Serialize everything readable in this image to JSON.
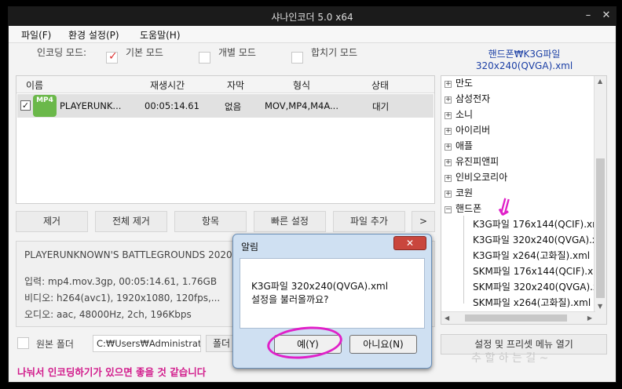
{
  "window": {
    "title": "샤나인코더  5.0  x64",
    "minimize": "–",
    "close": "✕"
  },
  "menu": {
    "file": "파일(F)",
    "settings": "환경 설정(P)",
    "help": "도움말(H)"
  },
  "modes": {
    "label": "인코딩 모드:",
    "basic": "기본 모드",
    "individual": "개별 모드",
    "merge": "합치기 모드"
  },
  "preset": {
    "path_line1": "핸드폰₩K3G파일",
    "path_line2": "320x240(QVGA).xml"
  },
  "list": {
    "headers": {
      "name": "이름",
      "duration": "재생시간",
      "subtitle": "자막",
      "format": "형식",
      "status": "상태"
    },
    "rows": [
      {
        "badge": "MP4",
        "name": "PLAYERUNK...",
        "duration": "00:05:14.61",
        "subtitle": "없음",
        "format": "MOV,MP4,M4A...",
        "status": "대기",
        "check": "✓"
      }
    ]
  },
  "buttons": {
    "remove": "제거",
    "remove_all": "전체 제거",
    "items": "항목",
    "quick_settings": "빠른 설정",
    "add_file": "파일 추가",
    "more": ">"
  },
  "info": {
    "title": "PLAYERUNKNOWN'S BATTLEGROUNDS 2020",
    "input": "입력: mp4.mov.3gp, 00:05:14.61, 1.76GB",
    "video": "비디오: h264(avc1), 1920x1080, 120fps,...",
    "audio": "오디오: aac, 48000Hz, 2ch, 196Kbps"
  },
  "output": {
    "source_folder_label": "원본 폴더",
    "path": "C:₩Users₩Administrator",
    "folder_btn": "폴더"
  },
  "tree": {
    "nodes": [
      {
        "label": "만도",
        "exp": "+"
      },
      {
        "label": "삼성전자",
        "exp": "+"
      },
      {
        "label": "소니",
        "exp": "+"
      },
      {
        "label": "아이리버",
        "exp": "+"
      },
      {
        "label": "애플",
        "exp": "+"
      },
      {
        "label": "유진피앤피",
        "exp": "+"
      },
      {
        "label": "인비오코리아",
        "exp": "+"
      },
      {
        "label": "코원",
        "exp": "+"
      },
      {
        "label": "핸드폰",
        "exp": "−"
      }
    ],
    "children": [
      "K3G파일 176x144(QCIF).xml",
      "K3G파일 320x240(QVGA).xml",
      "K3G파일 x264(고화질).xml",
      "SKM파일 176x144(QCIF).xml",
      "SKM파일 320x240(QVGA).xml",
      "SKM파일 x264(고화질).xml"
    ],
    "scroll_left": "◀",
    "scroll_right": "▶",
    "scroll_up": "▲",
    "scroll_down": "▼"
  },
  "preset_menu_btn": "설정 및 프리셋 메뉴 열기",
  "dialog": {
    "title": "알림",
    "close": "✕",
    "line1": "K3G파일 320x240(QVGA).xml",
    "line2": "설정을 불러올까요?",
    "yes": "예(Y)",
    "no": "아니요(N)"
  },
  "footer_note": "나눠서 인코딩하기가 있으면 좋을 것 같습니다",
  "watermark": "추 할 하 는 길 ~",
  "annotation": {
    "arrow": "⇙",
    "color": "#e020c8"
  }
}
